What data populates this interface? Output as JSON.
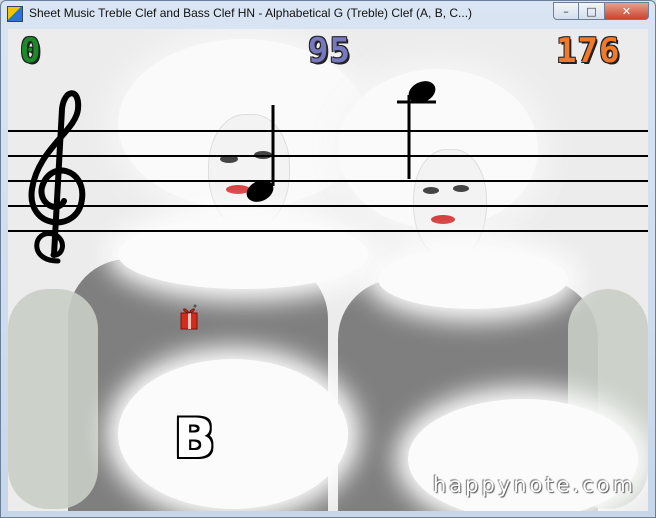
{
  "window": {
    "title": "Sheet Music Treble Clef and Bass Clef HN - Alphabetical G (Treble) Clef (A, B, C...)",
    "min_glyph": "–",
    "max_glyph": "□",
    "close_glyph": "✕"
  },
  "scores": {
    "left": "0",
    "center": "95",
    "right": "176"
  },
  "note_letter": "B",
  "watermark": "happynote.com",
  "colors": {
    "score_left": "#1d8a2a",
    "score_center": "#7878bf",
    "score_right": "#ef7a2c"
  },
  "icons": {
    "clef": "treble-clef-icon",
    "gift": "gift-icon"
  }
}
